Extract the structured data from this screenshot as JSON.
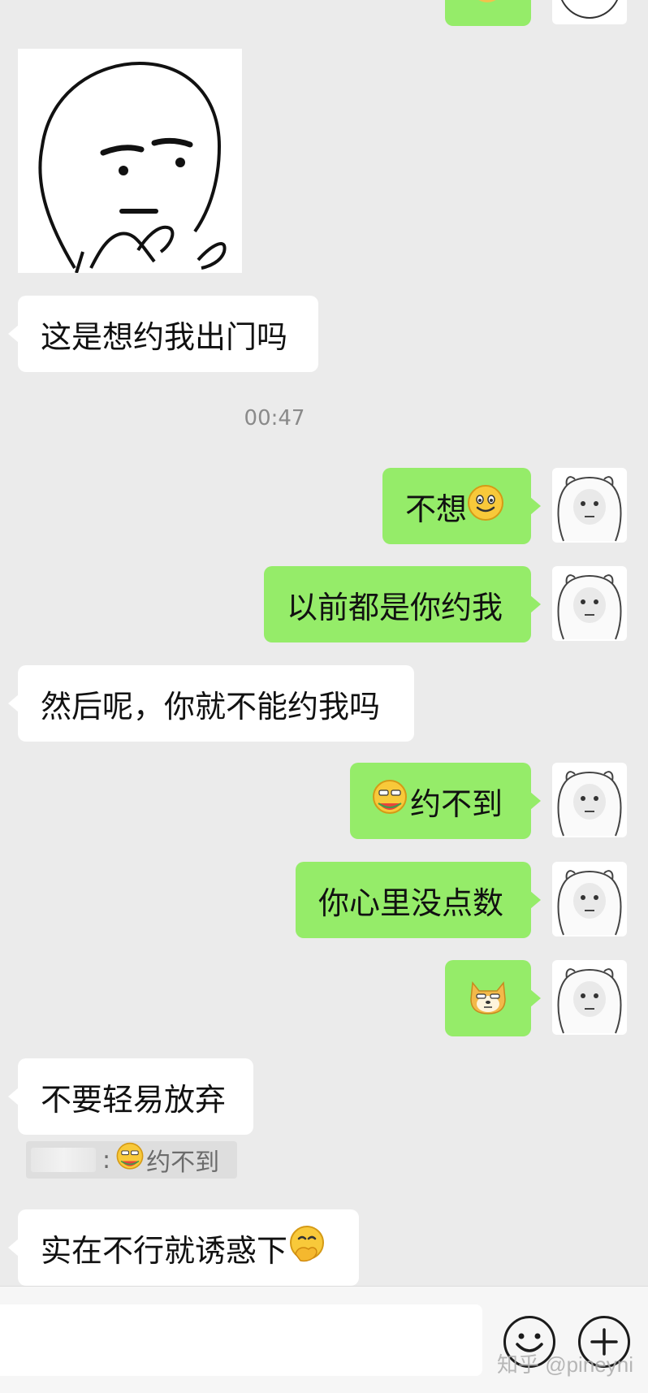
{
  "chat": {
    "timestamp": "00:47",
    "messages": [
      {
        "side": "right",
        "text": "",
        "emoji": "shiba-doge-emoji"
      },
      {
        "side": "left",
        "type": "sticker",
        "sticker": "thinking-face-sticker"
      },
      {
        "side": "left",
        "text": "这是想约我出门吗"
      },
      {
        "side": "right",
        "text": "不想",
        "emoji": "smile-emoji"
      },
      {
        "side": "right",
        "text": "以前都是你约我"
      },
      {
        "side": "left",
        "text": "然后呢，你就不能约我吗"
      },
      {
        "side": "right",
        "text": "约不到",
        "emoji": "eating-watermelon-emoji"
      },
      {
        "side": "right",
        "text": "你心里没点数"
      },
      {
        "side": "right",
        "text": "",
        "emoji": "shiba-doge-emoji"
      },
      {
        "side": "left",
        "text": "不要轻易放弃"
      },
      {
        "side": "left",
        "text": "实在不行就诱惑下",
        "emoji": "hand-over-mouth-emoji"
      }
    ],
    "quote": {
      "prefix": ":",
      "text": "约不到",
      "emoji": "eating-watermelon-emoji"
    }
  },
  "input": {
    "value": ""
  },
  "icons": {
    "emoji_button": "emoji-face-icon",
    "plus_button": "plus-icon"
  },
  "watermark": "知乎 @pineyni",
  "colors": {
    "right_bubble": "#95ec69",
    "left_bubble": "#ffffff",
    "background": "#ebebeb"
  }
}
